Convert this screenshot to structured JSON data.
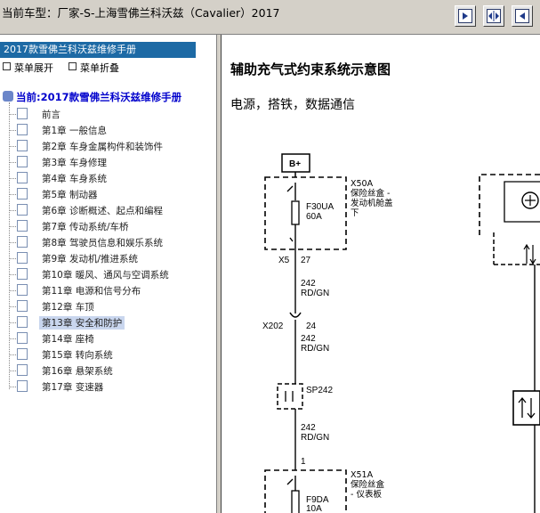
{
  "window": {
    "title": "当前车型：厂家-S-上海雪佛兰科沃兹（Cavalier）2017"
  },
  "toolbar": {
    "buttons": [
      "show-pane-icon",
      "split-panes-icon",
      "hide-pane-icon"
    ]
  },
  "left": {
    "manual_title": "2017款雪佛兰科沃兹维修手册",
    "expand_label": "菜单展开",
    "collapse_label": "菜单折叠",
    "root_label": "当前:2017款雪佛兰科沃兹维修手册",
    "items": [
      {
        "label": "前言"
      },
      {
        "label": "第1章  一般信息"
      },
      {
        "label": "第2章  车身金属构件和装饰件"
      },
      {
        "label": "第3章  车身修理"
      },
      {
        "label": "第4章  车身系统"
      },
      {
        "label": "第5章  制动器"
      },
      {
        "label": "第6章  诊断概述、起点和编程"
      },
      {
        "label": "第7章  传动系统/车桥"
      },
      {
        "label": "第8章  驾驶员信息和娱乐系统"
      },
      {
        "label": "第9章  发动机/推进系统"
      },
      {
        "label": "第10章  暖风、通风与空调系统"
      },
      {
        "label": "第11章  电源和信号分布"
      },
      {
        "label": "第12章  车顶"
      },
      {
        "label": "第13章  安全和防护"
      },
      {
        "label": "第14章  座椅"
      },
      {
        "label": "第15章  转向系统"
      },
      {
        "label": "第16章  悬架系统"
      },
      {
        "label": "第17章  变速器"
      }
    ],
    "selected_index": 13
  },
  "right": {
    "heading": "辅助充气式约束系统示意图",
    "subheading": "电源，搭铁，数据通信",
    "diagram": {
      "b_plus": "B+",
      "fuse1": {
        "code": "F30UA",
        "amp": "60A",
        "box": "X50A",
        "desc1": "保险丝盒 -",
        "desc2": "发动机舱盖",
        "desc3": "下"
      },
      "x5": "X5",
      "pin27": "27",
      "wire1": {
        "size": "242",
        "color": "RD/GN"
      },
      "x202": "X202",
      "pin24": "24",
      "wire2": {
        "size": "242",
        "color": "RD/GN"
      },
      "splice": "SP242",
      "wire3": {
        "size": "242",
        "color": "RD/GN"
      },
      "pin1": "1",
      "fuse2": {
        "code": "F9DA",
        "amp": "10A",
        "box": "X51A",
        "desc1": "保险丝盒",
        "desc2": "- 仪表板"
      }
    }
  }
}
